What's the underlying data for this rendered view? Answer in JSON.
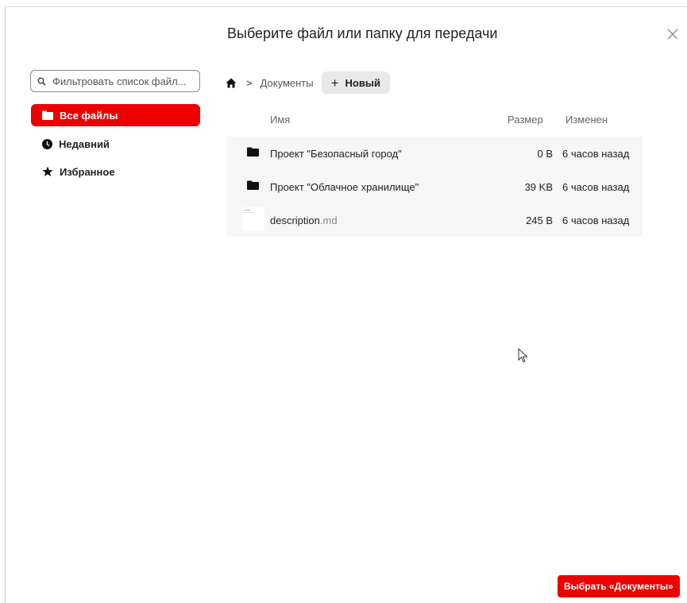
{
  "dialog": {
    "title": "Выберите файл или папку для передачи",
    "close_icon": "close-icon"
  },
  "sidebar": {
    "filter_placeholder": "Фильтровать список файл...",
    "items": [
      {
        "label": "Все файлы",
        "icon": "folder-icon",
        "active": true
      },
      {
        "label": "Недавний",
        "icon": "clock-icon",
        "active": false
      },
      {
        "label": "Избранное",
        "icon": "star-icon",
        "active": false
      }
    ]
  },
  "breadcrumb": {
    "home_icon": "home-icon",
    "separator": ">",
    "current": "Документы",
    "new_button_plus": "+",
    "new_button_label": "Новый"
  },
  "table": {
    "headers": {
      "name": "Имя",
      "size": "Размер",
      "modified": "Изменен"
    },
    "rows": [
      {
        "type": "folder",
        "name": "Проект \"Безопасный город\"",
        "ext": "",
        "size": "0 B",
        "modified": "6 часов назад"
      },
      {
        "type": "folder",
        "name": "Проект \"Облачное хранилище\"",
        "ext": "",
        "size": "39 KB",
        "modified": "6 часов назад"
      },
      {
        "type": "file",
        "name": "description",
        "ext": ".md",
        "size": "245 B",
        "modified": "6 часов назад"
      }
    ]
  },
  "footer": {
    "select_button": "Выбрать «Документы»"
  },
  "colors": {
    "accent": "#ec0000",
    "row_bg": "#f6f6f6"
  }
}
